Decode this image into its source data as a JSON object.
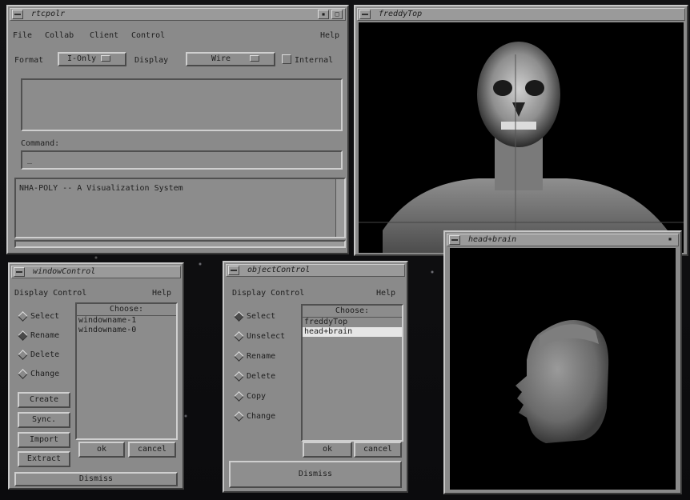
{
  "main_window": {
    "title": "rtcpolr",
    "menu": [
      "File",
      "Collab",
      "Client",
      "Control"
    ],
    "help_label": "Help",
    "format_label": "Format",
    "format_value": "I-Only",
    "display_label": "Display",
    "display_value": "Wire",
    "internal_label": "Internal",
    "command_label": "Command:",
    "command_value": "_",
    "output_text": "NHA-POLY -- A Visualization System"
  },
  "freddy_window": {
    "title": "freddyTop"
  },
  "head_window": {
    "title": "head+brain"
  },
  "window_control": {
    "title": "windowControl",
    "panel_title": "Display Control",
    "help_label": "Help",
    "radios": [
      {
        "label": "Select",
        "selected": false
      },
      {
        "label": "Rename",
        "selected": true
      },
      {
        "label": "Delete",
        "selected": false
      },
      {
        "label": "Change",
        "selected": false
      }
    ],
    "buttons": [
      "Create",
      "Sync.",
      "Import",
      "Extract"
    ],
    "choose_header": "Choose:",
    "items": [
      "windowname-1",
      "windowname-0"
    ],
    "ok_label": "ok",
    "cancel_label": "cancel",
    "dismiss_label": "Dismiss"
  },
  "object_control": {
    "title": "objectControl",
    "panel_title": "Display Control",
    "help_label": "Help",
    "radios": [
      {
        "label": "Select",
        "selected": true
      },
      {
        "label": "Unselect",
        "selected": false
      },
      {
        "label": "Rename",
        "selected": false
      },
      {
        "label": "Delete",
        "selected": false
      },
      {
        "label": "Copy",
        "selected": false
      },
      {
        "label": "Change",
        "selected": false
      }
    ],
    "choose_header": "Choose:",
    "items": [
      "freddyTop",
      "head+brain"
    ],
    "selected_item": "head+brain",
    "ok_label": "ok",
    "cancel_label": "cancel",
    "dismiss_label": "Dismiss"
  }
}
